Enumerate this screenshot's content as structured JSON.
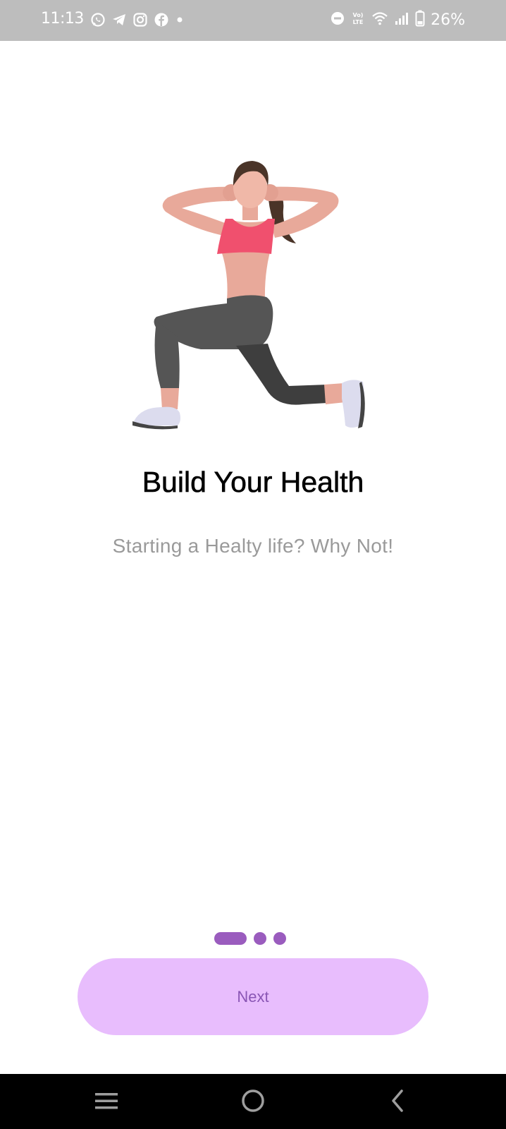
{
  "status_bar": {
    "time": "11:13",
    "battery": "26%",
    "left_icons": [
      "whatsapp-icon",
      "telegram-icon",
      "instagram-icon",
      "facebook-icon",
      "notification-dot-icon"
    ],
    "right_icons": [
      "do-not-disturb-icon",
      "volte-icon",
      "wifi-icon",
      "signal-icon",
      "battery-icon"
    ]
  },
  "onboarding": {
    "title": "Build Your Health",
    "subtitle": "Starting a Healty life? Why Not!",
    "page_index": 1,
    "page_count": 3
  },
  "next_button": {
    "label": "Next"
  },
  "navigation": {
    "items": [
      "recents-icon",
      "home-icon",
      "back-icon"
    ]
  },
  "colors": {
    "accent": "#9a5cbe",
    "button_bg": "#e8bdfd",
    "button_text": "#8a56b5",
    "status_bar": "#bdbdbd"
  }
}
